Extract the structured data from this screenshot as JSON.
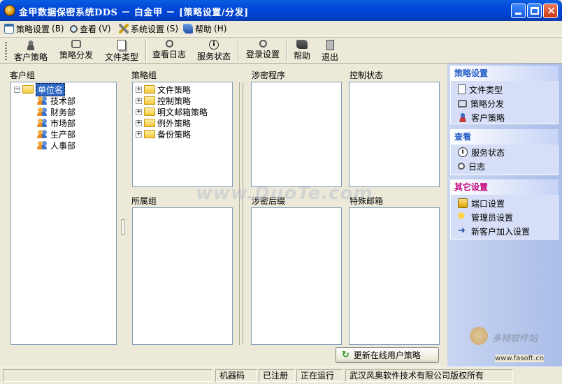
{
  "window": {
    "title": "金甲数据保密系统DDS － 白金甲 － [策略设置/分发]"
  },
  "menu": [
    {
      "label": "策略设置",
      "key": "(B)",
      "icon": "calendar-icon"
    },
    {
      "label": "查看",
      "key": "(V)",
      "icon": "magnifier-icon"
    },
    {
      "label": "系统设置",
      "key": "(S)",
      "icon": "tools-icon"
    },
    {
      "label": "帮助",
      "key": "(H)",
      "icon": "help-book-icon"
    }
  ],
  "toolbar": [
    {
      "label": "客户策略",
      "icon": "client-policy-icon"
    },
    {
      "label": "策略分发",
      "icon": "distribute-icon"
    },
    {
      "label": "文件类型",
      "icon": "file-type-icon"
    },
    {
      "label": "查看日志",
      "icon": "log-icon"
    },
    {
      "label": "服务状态",
      "icon": "info-icon"
    },
    {
      "label": "登录设置",
      "icon": "login-icon"
    },
    {
      "label": "帮助",
      "icon": "book-icon"
    },
    {
      "label": "退出",
      "icon": "exit-door-icon"
    }
  ],
  "client_group": {
    "label": "客户组",
    "root": "单位名",
    "children": [
      "技术部",
      "财务部",
      "市场部",
      "生产部",
      "人事部"
    ]
  },
  "policy_group": {
    "label": "策略组",
    "items": [
      "文件策略",
      "控制策略",
      "明文邮箱策略",
      "例外策略",
      "备份策略"
    ]
  },
  "member_group": {
    "label": "所属组"
  },
  "secret_program": {
    "label": "涉密程序"
  },
  "control_status": {
    "label": "控制状态"
  },
  "secret_suffix": {
    "label": "涉密后缀"
  },
  "special_mailbox": {
    "label": "特殊邮箱"
  },
  "update_button": {
    "label": "更新在线用户策略"
  },
  "taskpane": {
    "sections": [
      {
        "title": "策略设置",
        "items": [
          {
            "label": "文件类型",
            "icon": "file-type-icon"
          },
          {
            "label": "策略分发",
            "icon": "distribute-icon"
          },
          {
            "label": "客户策略",
            "icon": "client-policy-icon"
          }
        ]
      },
      {
        "title": "查看",
        "items": [
          {
            "label": "服务状态",
            "icon": "info-icon"
          },
          {
            "label": "日志",
            "icon": "magnifier-icon"
          }
        ]
      },
      {
        "title": "其它设置",
        "items": [
          {
            "label": "端口设置",
            "icon": "port-icon"
          },
          {
            "label": "管理员设置",
            "icon": "key-icon"
          },
          {
            "label": "新客户加入设置",
            "icon": "arrow-right-icon"
          }
        ]
      }
    ]
  },
  "statusbar": {
    "machine_code": "机器码",
    "registered": "已注册",
    "running": "正在运行",
    "copyright": "武汉风奥软件技术有限公司版权所有"
  },
  "watermark": {
    "text": "www.DuoTe.com",
    "brand": "多特软件站",
    "site": "www.fasoft.cn"
  },
  "colors": {
    "titlebar": "#0048d8",
    "selection": "#316ac5",
    "taskpane_head": "#215dc6",
    "taskpane_pink": "#c4007a"
  }
}
